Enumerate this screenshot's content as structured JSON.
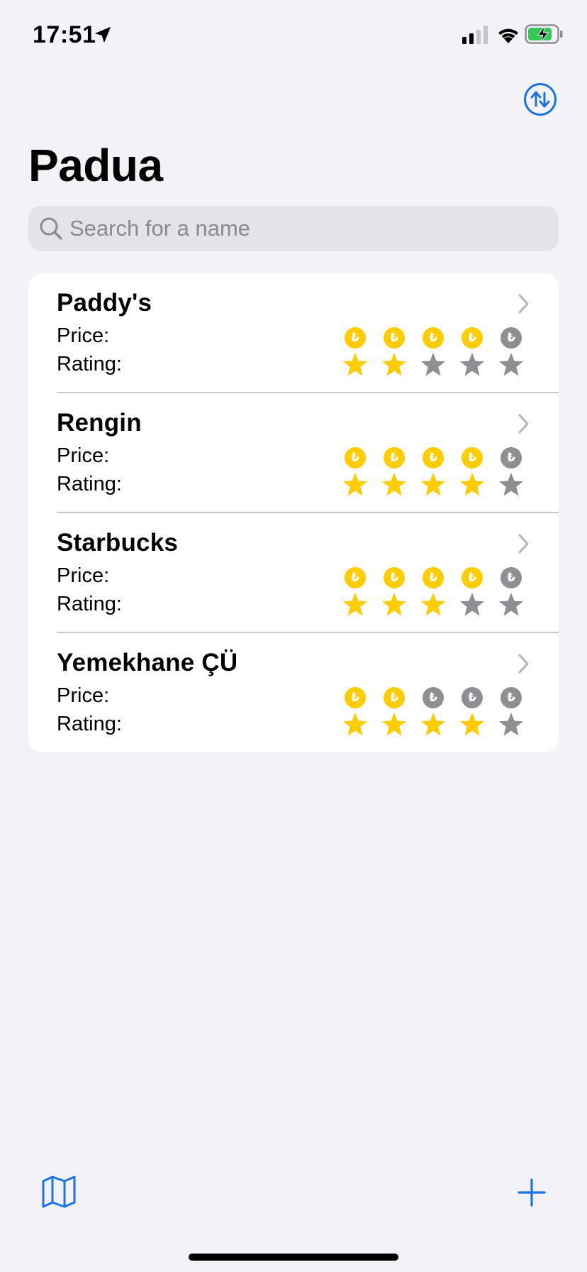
{
  "status_bar": {
    "time": "17:51",
    "icons": [
      "location-arrow-icon",
      "cellular-signal-icon",
      "wifi-icon",
      "battery-charging-icon"
    ]
  },
  "colors": {
    "accent": "#1a73e8",
    "gold": "#ffcc00",
    "gray": "#8e8e93",
    "background": "#f2f2f7"
  },
  "header": {
    "title": "Padua",
    "sort_icon": "sort-arrows-icon"
  },
  "search": {
    "placeholder": "Search for a name",
    "value": ""
  },
  "labels": {
    "price": "Price:",
    "rating": "Rating:"
  },
  "currency_symbol": "₺",
  "places": [
    {
      "name": "Paddy's",
      "price": 4,
      "rating": 2
    },
    {
      "name": "Rengin",
      "price": 4,
      "rating": 4
    },
    {
      "name": "Starbucks",
      "price": 4,
      "rating": 3
    },
    {
      "name": "Yemekhane ÇÜ",
      "price": 2,
      "rating": 4
    }
  ],
  "max_level": 5,
  "toolbar": {
    "left_icon": "map-icon",
    "right_icon": "plus-icon"
  }
}
